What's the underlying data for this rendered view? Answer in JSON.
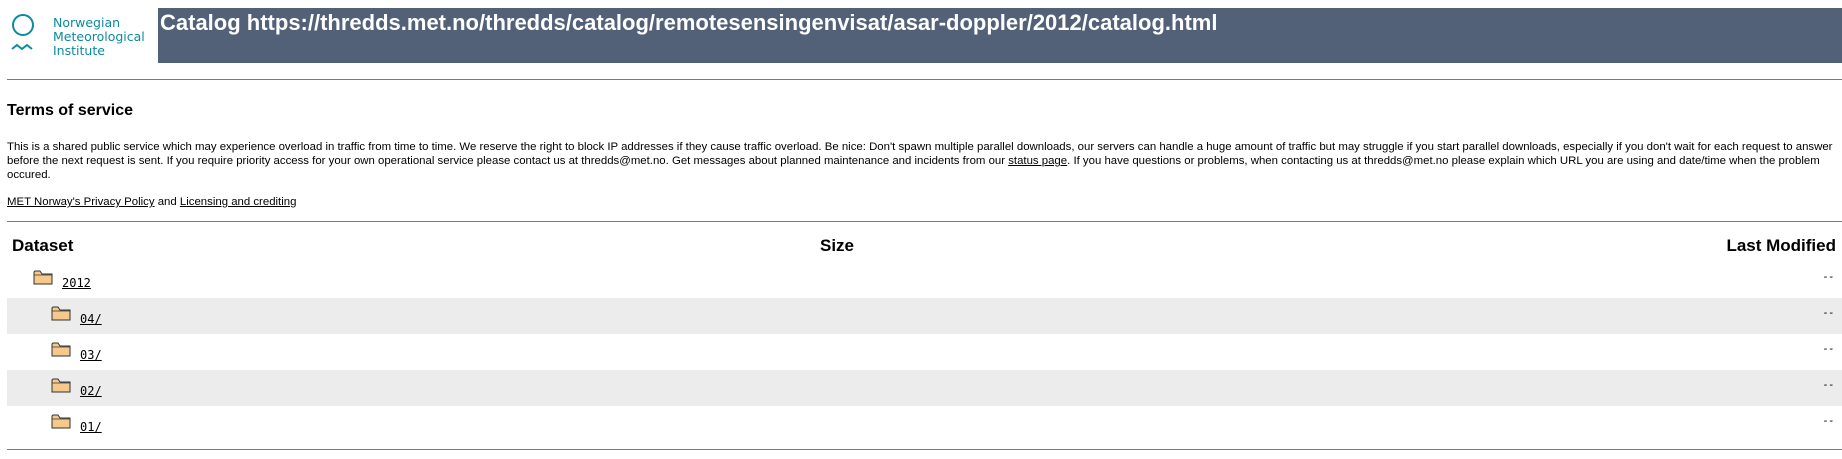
{
  "logo": {
    "line1": "Norwegian",
    "line2": "Meteorological",
    "line3": "Institute"
  },
  "title": "Catalog https://thredds.met.no/thredds/catalog/remotesensingenvisat/asar-doppler/2012/catalog.html",
  "tos": {
    "heading": "Terms of service",
    "body_part1": "This is a shared public service which may experience overload in traffic from time to time. We reserve the right to block IP addresses if they cause traffic overload. Be nice: Don't spawn multiple parallel downloads, our servers can handle a huge amount of traffic but may struggle if you start parallel downloads, especially if you don't wait for each request to answer before the next request is sent. If you require priority access for your own operational service please contact us at thredds@met.no. Get messages about planned maintenance and incidents from our ",
    "status_link": "status page",
    "body_part2": ". If you have questions or problems, when contacting us at thredds@met.no please explain which URL you are using and date/time when the problem occured."
  },
  "links": {
    "privacy": "MET Norway's Privacy Policy",
    "and": "and",
    "licensing": "Licensing and crediting"
  },
  "table": {
    "headers": {
      "dataset": "Dataset",
      "size": "Size",
      "last_modified": "Last Modified"
    },
    "rows": [
      {
        "name": "2012",
        "size": "",
        "modified": "--"
      },
      {
        "name": "04/",
        "size": "",
        "modified": "--"
      },
      {
        "name": "03/",
        "size": "",
        "modified": "--"
      },
      {
        "name": "02/",
        "size": "",
        "modified": "--"
      },
      {
        "name": "01/",
        "size": "",
        "modified": "--"
      }
    ]
  },
  "colors": {
    "title_bar": "#526078",
    "logo_teal": "#0d8a9e",
    "row_alt": "#ececec",
    "folder_fill": "#f5c98b"
  },
  "icons": {
    "folder": "folder-icon",
    "logo": "met-logo-icon"
  }
}
